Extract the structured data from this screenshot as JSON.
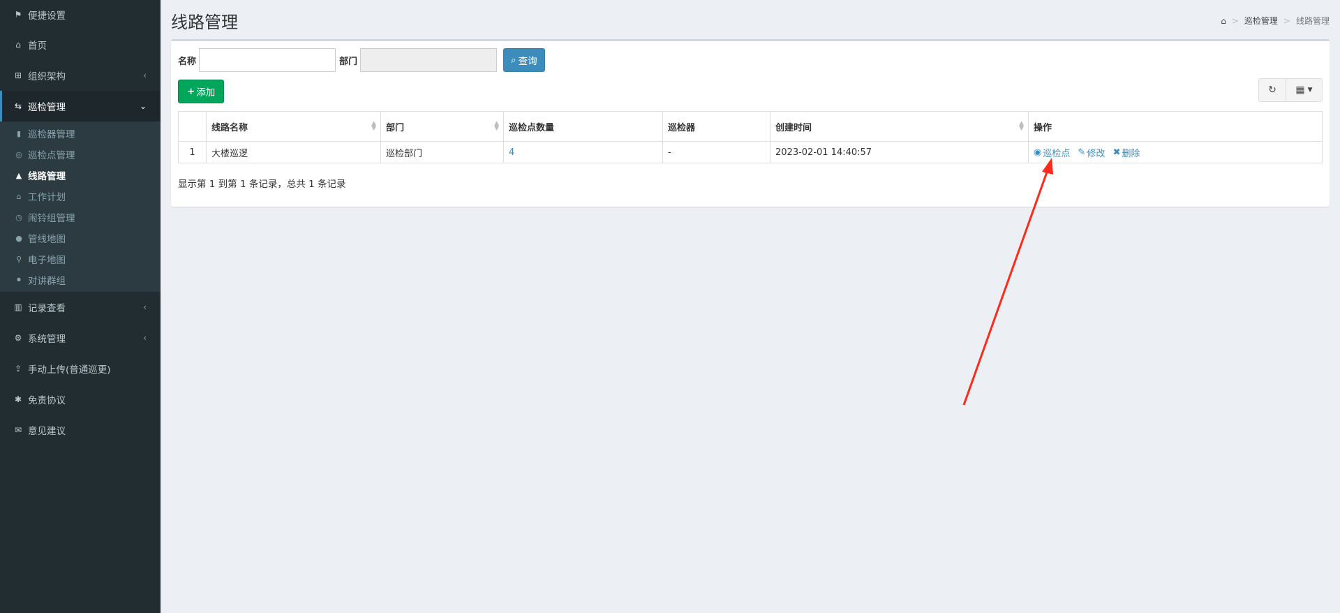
{
  "sidebar": {
    "items": [
      {
        "label": "便捷设置",
        "icon": "flag-icon"
      },
      {
        "label": "首页",
        "icon": "home-icon"
      },
      {
        "label": "组织架构",
        "icon": "sitemap-icon"
      },
      {
        "label": "巡检管理",
        "icon": "road-sign-icon"
      },
      {
        "label": "记录查看",
        "icon": "bar-chart-icon"
      },
      {
        "label": "系统管理",
        "icon": "gear-icon"
      },
      {
        "label": "手动上传(普通巡更)",
        "icon": "upload-icon"
      },
      {
        "label": "免责协议",
        "icon": "asterisk-icon"
      },
      {
        "label": "意见建议",
        "icon": "envelope-open-icon"
      }
    ],
    "submenu": [
      {
        "label": "巡检器管理",
        "icon": "device-icon"
      },
      {
        "label": "巡检点管理",
        "icon": "location-pin-icon"
      },
      {
        "label": "线路管理",
        "icon": "road-icon"
      },
      {
        "label": "工作计划",
        "icon": "institution-icon"
      },
      {
        "label": "闹铃组管理",
        "icon": "clock-icon"
      },
      {
        "label": "管线地图",
        "icon": "map-marker-icon"
      },
      {
        "label": "电子地图",
        "icon": "pushpin-icon"
      },
      {
        "label": "对讲群组",
        "icon": "microphone-icon"
      }
    ]
  },
  "header": {
    "title": "线路管理",
    "breadcrumb": [
      "巡检管理",
      "线路管理"
    ]
  },
  "search": {
    "name_label": "名称",
    "name_value": "",
    "dept_label": "部门",
    "dept_value": "",
    "query_label": "查询"
  },
  "toolbar": {
    "add_label": "添加"
  },
  "table": {
    "headers": [
      "",
      "线路名称",
      "部门",
      "巡检点数量",
      "巡检器",
      "创建时间",
      "操作"
    ],
    "rows": [
      {
        "index": "1",
        "name": "大楼巡逻",
        "dept": "巡检部门",
        "points": "4",
        "device": "-",
        "created": "2023-02-01 14:40:57"
      }
    ],
    "actions": {
      "points": "巡检点",
      "edit": "修改",
      "delete": "删除"
    }
  },
  "pager": {
    "info": "显示第 1 到第 1 条记录，总共 1 条记录"
  },
  "colors": {
    "sidebar_bg": "#222d32",
    "primary": "#3c8dbc",
    "success": "#00a65a",
    "annotation": "#ff2a1a"
  }
}
